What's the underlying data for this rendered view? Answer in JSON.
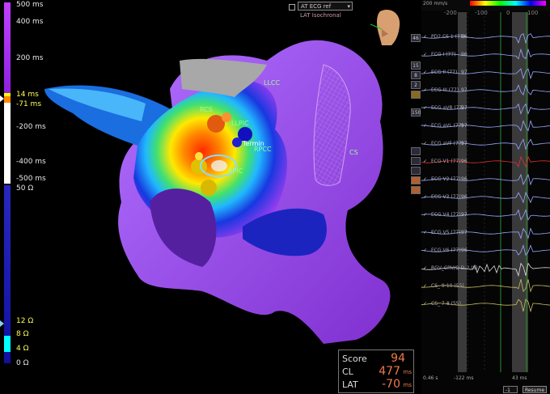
{
  "scale": {
    "time_labels": [
      "500 ms",
      "400 ms",
      "200 ms",
      "14 ms",
      "-71 ms",
      "-200 ms",
      "-400 ms",
      "-500 ms"
    ],
    "impedance_labels": [
      "50 Ω",
      "12 Ω",
      "8 Ω",
      "4 Ω",
      "0 Ω"
    ]
  },
  "map": {
    "select_value": "AT ECG ref",
    "subtitle": "LAT Isochronal",
    "labels": [
      "LLCC",
      "RCS",
      "LLPIC",
      "Termin",
      "RPCC",
      "CS",
      "RPIC"
    ]
  },
  "score": {
    "score_label": "Score",
    "score_value": "94",
    "cl_label": "CL",
    "cl_value": "477",
    "cl_unit": "ms",
    "lat_label": "LAT",
    "lat_value": "-70",
    "lat_unit": "ms"
  },
  "toolbar": {
    "buttons": [
      "46",
      "15",
      "8",
      "2",
      "150"
    ]
  },
  "ecg": {
    "speed": "200 mm/s",
    "axis": [
      "-200",
      "-100",
      "0",
      "100"
    ],
    "channels": [
      {
        "label": "PD2 CS 1 (77)",
        "value": "96"
      },
      {
        "label": "ECG I (77)",
        "value": "96"
      },
      {
        "label": "ECG II (77)",
        "value": "97"
      },
      {
        "label": "ECG III (77)",
        "value": "97"
      },
      {
        "label": "ECG aVR (77)",
        "value": "97"
      },
      {
        "label": "ECG aVL (77)",
        "value": "97"
      },
      {
        "label": "ECG aVF (77)",
        "value": "97"
      },
      {
        "label": "ECG V1 (77)",
        "value": "96"
      },
      {
        "label": "ECG V2 (77)",
        "value": "96"
      },
      {
        "label": "ECG V3 (77)",
        "value": "96"
      },
      {
        "label": "ECG V4 (77)",
        "value": "97"
      },
      {
        "label": "ECG V5 (77)",
        "value": "97"
      },
      {
        "label": "ECG V6 (77)",
        "value": "96"
      },
      {
        "label": "RGV_CRV/Q D-2 (8)",
        "value": ""
      },
      {
        "label": "CS_ 9-10 (55)",
        "value": ""
      },
      {
        "label": "CS_ 7-8 (55)",
        "value": ""
      }
    ],
    "bottom_left": "0.46 s",
    "bottom_mid": "-122 ms",
    "bottom_right": "43 ms",
    "page_value": "-1",
    "resume_label": "Resume"
  },
  "colors": {
    "accent": "#f07a4a",
    "scale_purple": "#a020e0",
    "scale_blue": "#1010b0"
  }
}
